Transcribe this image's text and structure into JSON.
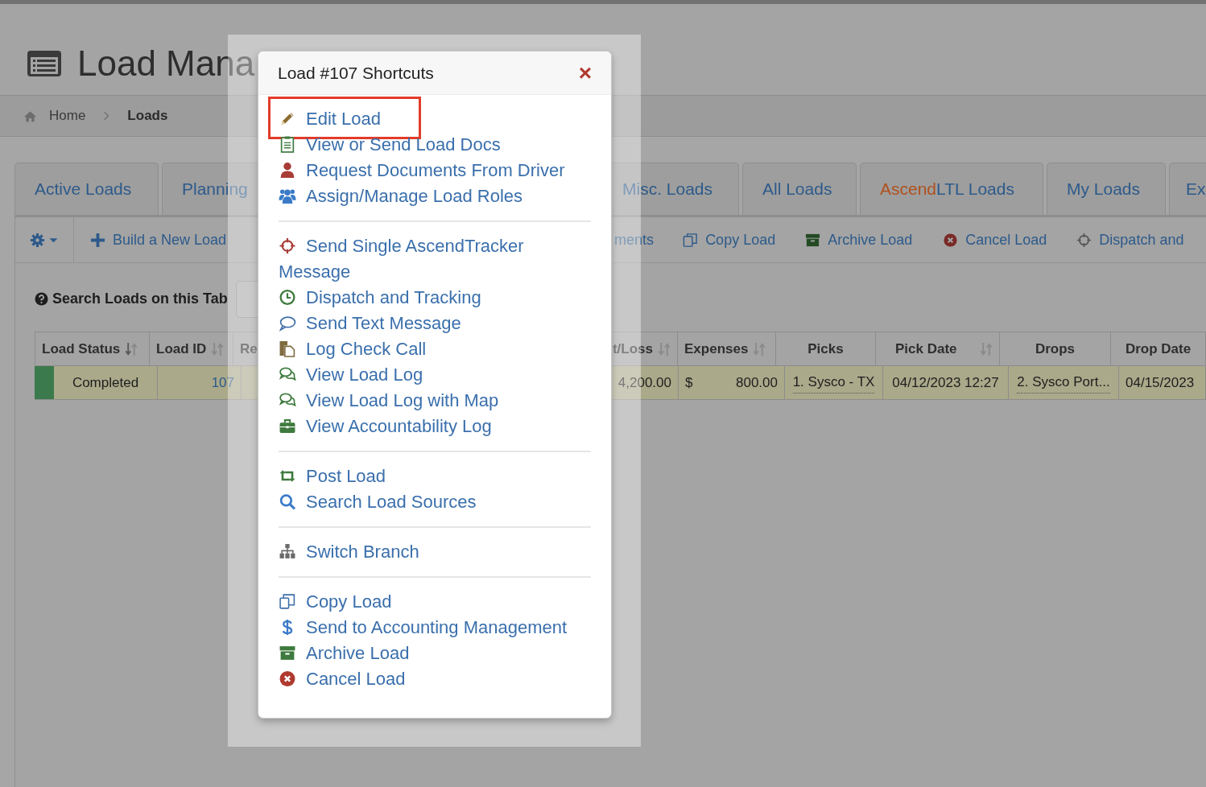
{
  "page_title": "Load Mana",
  "breadcrumb": [
    {
      "label": "Home",
      "current": false
    },
    {
      "label": "Loads",
      "current": true
    }
  ],
  "tabs": [
    {
      "label": "Active Loads",
      "selected": false
    },
    {
      "label": "Planning",
      "selected": false
    },
    {
      "label": "Misc. Loads",
      "selected": false
    },
    {
      "label": "All Loads",
      "selected": false
    },
    {
      "prefix": "Ascend",
      "label": "LTL Loads",
      "selected": false
    },
    {
      "label": "My Loads",
      "selected": false
    },
    {
      "label": "Ex",
      "selected": false
    }
  ],
  "toolbar": [
    {
      "label": "Build a New Load"
    },
    {
      "label": "ments"
    },
    {
      "label": "Copy Load"
    },
    {
      "label": "Archive Load"
    },
    {
      "label": "Cancel Load"
    },
    {
      "label": "Dispatch and"
    }
  ],
  "search": {
    "label": "Search Loads on this Tab"
  },
  "table": {
    "columns": [
      {
        "label": "Load Status",
        "sortable": true
      },
      {
        "label": "Load ID",
        "sortable": true
      },
      {
        "label": "Re",
        "sortable": false
      },
      {
        "label": "t/Loss",
        "sortable": true
      },
      {
        "label": "Expenses",
        "sortable": true
      },
      {
        "label": "Picks",
        "sortable": false
      },
      {
        "label": "Pick Date",
        "sortable": true
      },
      {
        "label": "Drops",
        "sortable": false
      },
      {
        "label": "Drop Date",
        "sortable": false
      }
    ],
    "rows": [
      {
        "color": "#3b7a4c",
        "cells": [
          {
            "text": "Completed",
            "underlined": false
          },
          {
            "text": "107",
            "underlined": false
          },
          {
            "text": ""
          },
          {
            "text": "4,200.00",
            "underlined": false
          },
          {
            "currency": "$",
            "text": "800.00",
            "underlined": false
          },
          {
            "text": "1. Sysco - TX",
            "underlined": true
          },
          {
            "text": "04/12/2023 12:27",
            "underlined": false
          },
          {
            "text": "2. Sysco Port...",
            "underlined": true
          },
          {
            "text": "04/15/2023",
            "underlined": false
          }
        ]
      }
    ]
  },
  "popover": {
    "title": "Load #107 Shortcuts",
    "close": "×",
    "sections": [
      {
        "items": [
          {
            "label": "Edit Load",
            "highlighted": true
          },
          {
            "label": "View or Send Load Docs",
            "highlighted": false
          },
          {
            "label": "Request Documents From Driver",
            "highlighted": false
          },
          {
            "label": "Assign/Manage Load Roles",
            "highlighted": false
          }
        ]
      },
      {
        "items": [
          {
            "label": "Send Single AscendTracker Message",
            "highlighted": false
          },
          {
            "label": "Dispatch and Tracking",
            "highlighted": false
          },
          {
            "label": "Send Text Message",
            "highlighted": false
          },
          {
            "label": "Log Check Call",
            "highlighted": false
          },
          {
            "label": "View Load Log",
            "highlighted": false
          },
          {
            "label": "View Load Log with Map",
            "highlighted": false
          },
          {
            "label": "View Accountability Log",
            "highlighted": false
          }
        ]
      },
      {
        "items": [
          {
            "label": "Post Load",
            "highlighted": false
          },
          {
            "label": "Search Load Sources",
            "highlighted": false
          }
        ]
      },
      {
        "items": [
          {
            "label": "Switch Branch",
            "highlighted": false
          }
        ]
      },
      {
        "items": [
          {
            "label": "Copy Load",
            "highlighted": false
          },
          {
            "label": "Send to Accounting Management",
            "highlighted": false
          },
          {
            "label": "Archive Load",
            "highlighted": false
          },
          {
            "label": "Cancel Load",
            "highlighted": false
          }
        ]
      }
    ]
  }
}
